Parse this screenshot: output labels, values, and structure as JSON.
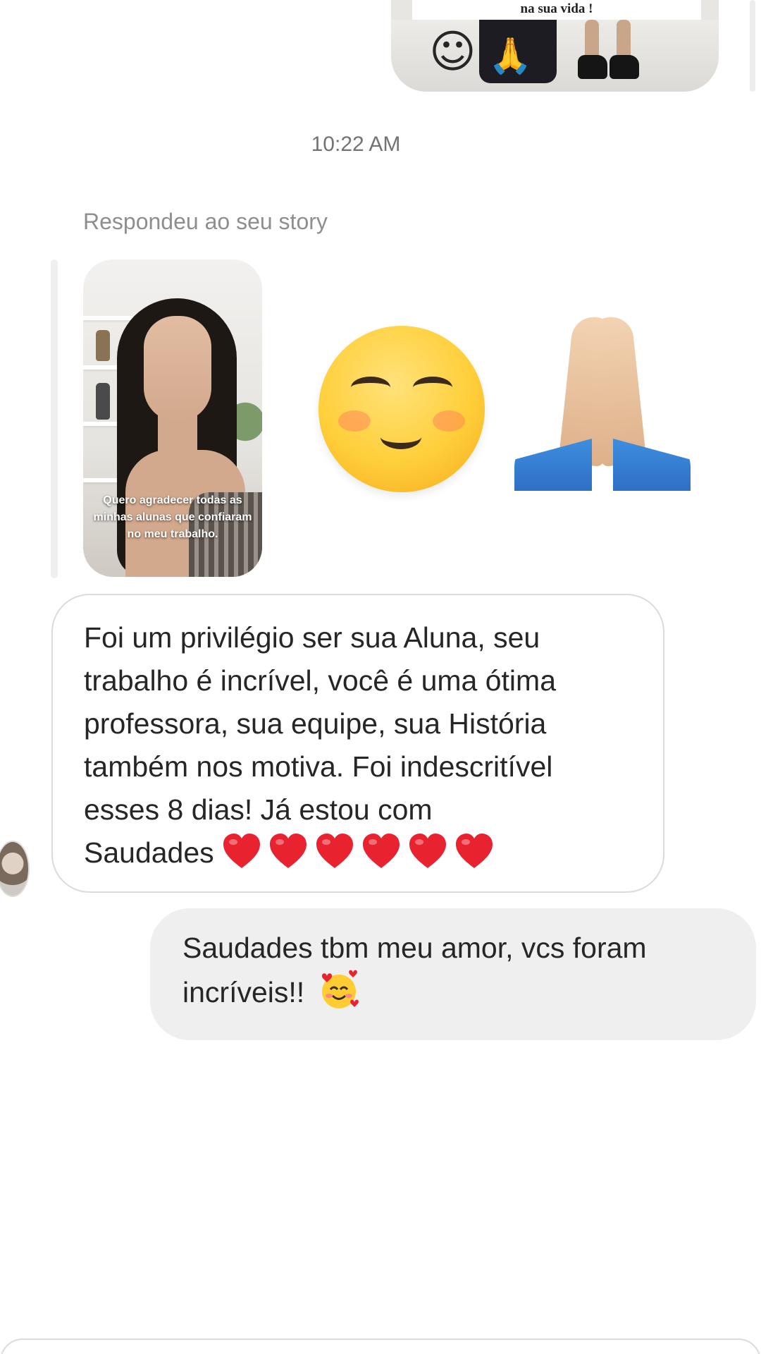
{
  "top_story": {
    "caption": "na sua vida !",
    "emoji": "smiling-face-emoji"
  },
  "timestamp": "10:22 AM",
  "story_reply": {
    "label": "Respondeu ao seu story",
    "story_caption": "Quero agradecer todas as minhas alunas que confiaram no meu trabalho.",
    "reactions": [
      "smiling-face-emoji",
      "folded-hands-emoji"
    ]
  },
  "received_message": {
    "lines": [
      "Foi um privilégio ser sua Aluna, seu",
      "trabalho é incrível, você é uma ótima",
      "professora, sua equipe, sua História",
      "também nos motiva. Foi indescritível",
      "esses 8 dias! Já estou com",
      "Saudades"
    ],
    "heart_count": 6,
    "heart_color": "#e8232f"
  },
  "sent_message": {
    "lines": [
      "Saudades tbm meu amor, vcs foram",
      "incríveis!!"
    ],
    "emoji": "smiling-face-with-hearts-emoji"
  },
  "colors": {
    "sent_bubble": "#efefef",
    "received_border": "#dbdbdb",
    "meta_text": "#8e8e8e"
  }
}
